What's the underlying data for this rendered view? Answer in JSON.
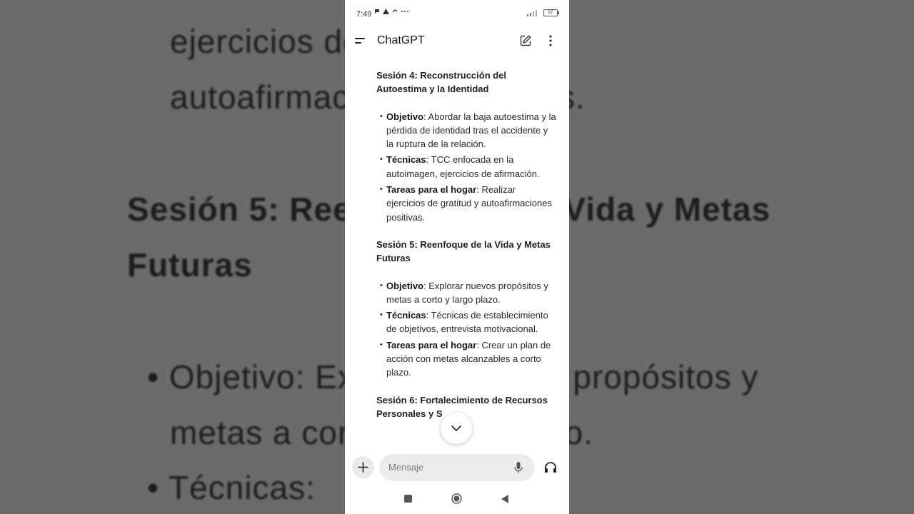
{
  "status_bar": {
    "time": "7:49",
    "battery": "87"
  },
  "app_bar": {
    "title": "ChatGPT"
  },
  "background_text": [
    "ejercicios de",
    "autoafirmaciones positivas.",
    "Sesión 5: Reenfoque de la Vida y Metas",
    "Futuras",
    "• Objetivo: Explorar nuevos propósitos y",
    "metas a corto y largo plazo.",
    "• Técnicas:"
  ],
  "content": {
    "sessions": [
      {
        "title": "Sesión 4: Reconstrucción del Autoestima y la Identidad",
        "bullets": [
          {
            "label": "Objetivo",
            "text": ": Abordar la baja autoestima y la pérdida de identidad tras el accidente y la ruptura de la relación."
          },
          {
            "label": "Técnicas",
            "text": ": TCC enfocada en la autoimagen, ejercicios de afirmación."
          },
          {
            "label": "Tareas para el hogar",
            "text": ": Realizar ejercicios de gratitud y autoafirmaciones positivas."
          }
        ]
      },
      {
        "title": "Sesión 5: Reenfoque de la Vida y Metas Futuras",
        "bullets": [
          {
            "label": "Objetivo",
            "text": ": Explorar nuevos propósitos y metas a corto y largo plazo."
          },
          {
            "label": "Técnicas",
            "text": ": Técnicas de establecimiento de objetivos, entrevista motivacional."
          },
          {
            "label": "Tareas para el hogar",
            "text": ": Crear un plan de acción con metas alcanzables a corto plazo."
          }
        ]
      },
      {
        "title": "Sesión 6: Fortalecimiento de Recursos Personales y S",
        "bullets": []
      }
    ]
  },
  "composer": {
    "placeholder": "Mensaje"
  },
  "icons": {
    "menu": "menu-icon",
    "edit": "edit-icon",
    "more": "more-vertical-icon",
    "scroll": "chevron-down-icon",
    "plus": "plus-icon",
    "mic": "mic-icon",
    "headphones": "headphones-icon"
  }
}
